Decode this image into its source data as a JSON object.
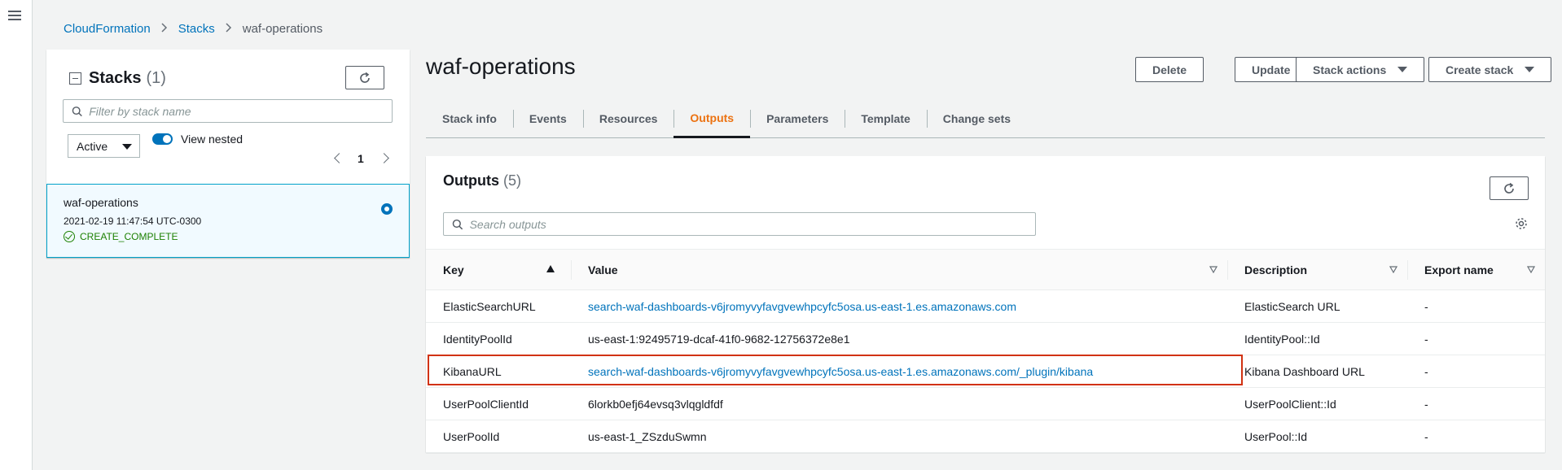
{
  "nav": {
    "menu_icon": "hamburger-menu-icon"
  },
  "breadcrumb": {
    "items": [
      "CloudFormation",
      "Stacks"
    ],
    "current": "waf-operations"
  },
  "stacks_panel": {
    "title": "Stacks",
    "count": "(1)",
    "filter_placeholder": "Filter by stack name",
    "status_filter": "Active",
    "view_nested_label": "View nested",
    "view_nested_on": true,
    "page": "1",
    "stack": {
      "name": "waf-operations",
      "date": "2021-02-19 11:47:54 UTC-0300",
      "status": "CREATE_COMPLETE",
      "status_color": "#1d8102"
    }
  },
  "main": {
    "title": "waf-operations",
    "buttons": {
      "delete": "Delete",
      "update": "Update",
      "stack_actions": "Stack actions",
      "create_stack": "Create stack"
    },
    "tabs": [
      "Stack info",
      "Events",
      "Resources",
      "Outputs",
      "Parameters",
      "Template",
      "Change sets"
    ],
    "active_tab": "Outputs",
    "accent_color": "#ec7211"
  },
  "outputs": {
    "title": "Outputs",
    "count": "(5)",
    "search_placeholder": "Search outputs",
    "columns": [
      "Key",
      "Value",
      "Description",
      "Export name"
    ],
    "rows": [
      {
        "key": "ElasticSearchURL",
        "value": "search-waf-dashboards-v6jromyvyfavgvewhpcyfc5osa.us-east-1.es.amazonaws.com",
        "description": "ElasticSearch URL",
        "export": "-"
      },
      {
        "key": "IdentityPoolId",
        "value": "us-east-1:92495719-dcaf-41f0-9682-12756372e8e1",
        "description": "IdentityPool::Id",
        "export": "-"
      },
      {
        "key": "KibanaURL",
        "value": "search-waf-dashboards-v6jromyvyfavgvewhpcyfc5osa.us-east-1.es.amazonaws.com/_plugin/kibana",
        "description": "Kibana Dashboard URL",
        "export": "-"
      },
      {
        "key": "UserPoolClientId",
        "value": "6lorkb0efj64evsq3vlqgldfdf",
        "description": "UserPoolClient::Id",
        "export": "-"
      },
      {
        "key": "UserPoolId",
        "value": "us-east-1_ZSzduSwmn",
        "description": "UserPool::Id",
        "export": "-"
      }
    ],
    "highlight_color": "#d13212"
  }
}
